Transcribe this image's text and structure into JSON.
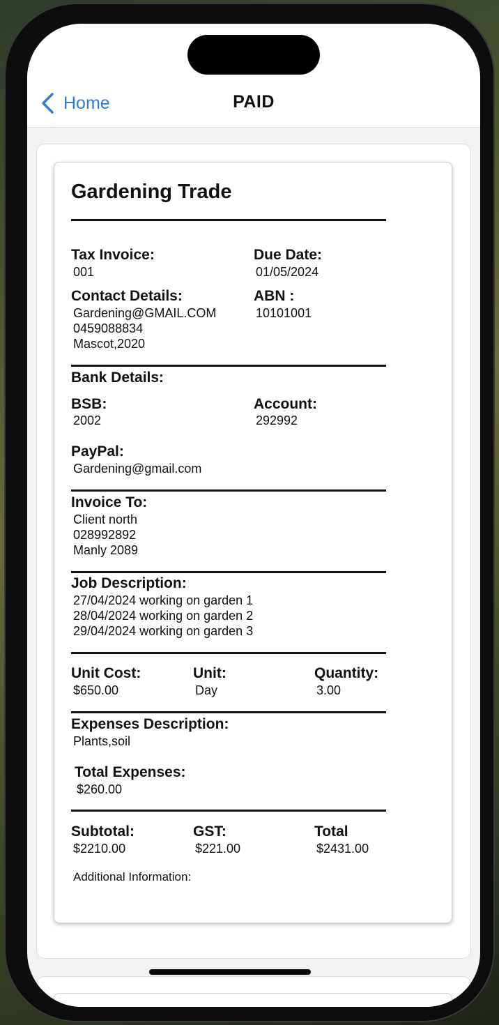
{
  "nav": {
    "back_label": "Home",
    "title": "PAID"
  },
  "invoice": {
    "business_name": "Gardening Trade",
    "tax_invoice_label": "Tax Invoice:",
    "tax_invoice_value": "001",
    "due_date_label": "Due Date:",
    "due_date_value": "01/05/2024",
    "contact_label": "Contact Details:",
    "contact_lines": [
      "Gardening@GMAIL.COM",
      "0459088834",
      "Mascot,2020"
    ],
    "abn_label": "ABN :",
    "abn_value": "10101001",
    "bank_label": "Bank Details:",
    "bsb_label": "BSB:",
    "bsb_value": "2002",
    "account_label": "Account:",
    "account_value": "292992",
    "paypal_label": "PayPal:",
    "paypal_value": "Gardening@gmail.com",
    "invoice_to_label": "Invoice To:",
    "invoice_to_lines": [
      "Client north",
      "028992892",
      "Manly 2089"
    ],
    "job_label": "Job Description:",
    "job_lines": [
      "27/04/2024 working on garden 1",
      "28/04/2024 working on garden 2",
      "29/04/2024 working on garden 3"
    ],
    "unit_cost_label": "Unit Cost:",
    "unit_cost_value": "$650.00",
    "unit_label": "Unit:",
    "unit_value": "Day",
    "quantity_label": "Quantity:",
    "quantity_value": "3.00",
    "expenses_desc_label": "Expenses Description:",
    "expenses_desc_value": "Plants,soil",
    "total_expenses_label": "Total Expenses:",
    "total_expenses_value": "$260.00",
    "subtotal_label": "Subtotal:",
    "subtotal_value": "$2210.00",
    "gst_label": "GST:",
    "gst_value": "$221.00",
    "total_label": "Total",
    "total_value": "$2431.00",
    "additional_info_label": "Additional Information:"
  },
  "colors": {
    "accent": "#2f7bdc"
  }
}
